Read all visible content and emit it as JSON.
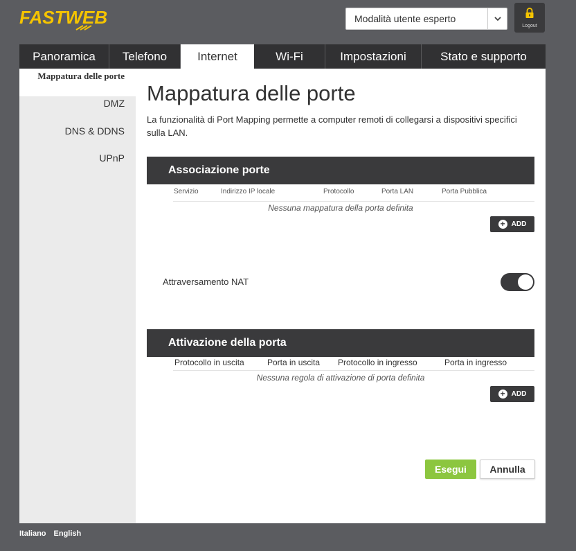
{
  "brand": {
    "logo_text": "FASTWEB",
    "logo_color": "#f5c400"
  },
  "header": {
    "mode_select": {
      "value": "Modalità utente esperto"
    },
    "logout_label": "Logout"
  },
  "tabs": [
    {
      "label": "Panoramica",
      "active": false
    },
    {
      "label": "Telefono",
      "active": false
    },
    {
      "label": "Internet",
      "active": true
    },
    {
      "label": "Wi-Fi",
      "active": false
    },
    {
      "label": "Impostazioni",
      "active": false
    },
    {
      "label": "Stato e supporto",
      "active": false
    }
  ],
  "sidebar": {
    "items": [
      {
        "label": "Mappatura delle porte",
        "active": true
      },
      {
        "label": "DMZ",
        "active": false
      },
      {
        "label": "DNS & DDNS",
        "active": false
      },
      {
        "label": "UPnP",
        "active": false
      }
    ]
  },
  "main": {
    "title": "Mappatura delle porte",
    "description": "La funzionalità di Port Mapping permette a computer remoti di collegarsi a dispositivi specifici sulla LAN.",
    "port_mapping": {
      "heading": "Associazione porte",
      "columns": [
        "Servizio",
        "Indirizzo IP locale",
        "Protocollo",
        "Porta LAN",
        "Porta Pubblica"
      ],
      "empty_message": "Nessuna mappatura della porta definita",
      "add_label": "ADD"
    },
    "nat": {
      "label": "Attraversamento NAT",
      "enabled": true
    },
    "port_triggering": {
      "heading": "Attivazione della porta",
      "columns": [
        "Protocollo in uscita",
        "Porta in uscita",
        "Protocollo in ingresso",
        "Porta in ingresso"
      ],
      "empty_message": "Nessuna regola di attivazione di porta definita",
      "add_label": "ADD"
    },
    "actions": {
      "apply_label": "Esegui",
      "cancel_label": "Annulla"
    }
  },
  "footer": {
    "languages": [
      "Italiano",
      "English"
    ]
  },
  "colors": {
    "accent_green": "#8cc63f",
    "dark": "#3a3a3c",
    "background": "#5b5c60"
  }
}
